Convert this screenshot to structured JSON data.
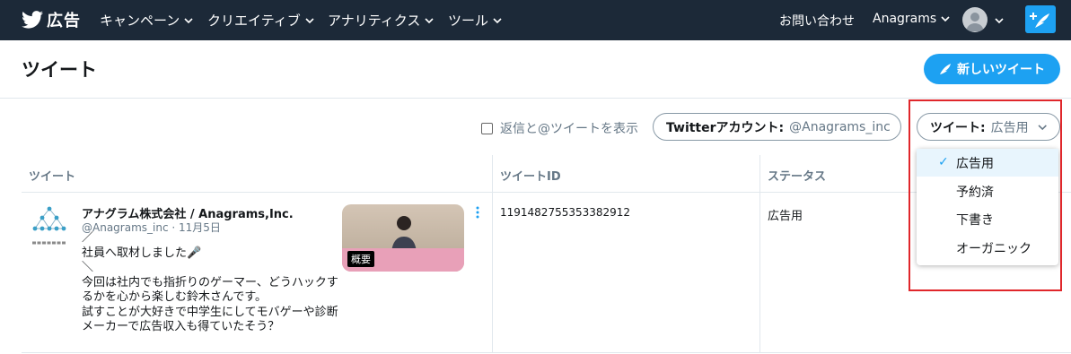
{
  "topnav": {
    "brand": "広告",
    "menu": [
      {
        "label": "キャンペーン"
      },
      {
        "label": "クリエイティブ"
      },
      {
        "label": "アナリティクス"
      },
      {
        "label": "ツール"
      }
    ],
    "contact": "お問い合わせ",
    "account": "Anagrams"
  },
  "page": {
    "title": "ツイート",
    "new_tweet": "新しいツイート"
  },
  "filters": {
    "show_replies_label": "返信と@ツイートを表示",
    "twitter_account_key": "Twitterアカウント:",
    "twitter_account_value": "@Anagrams_inc",
    "tweet_type_key": "ツイート:",
    "tweet_type_value": "広告用"
  },
  "table": {
    "headers": [
      "ツイート",
      "ツイートID",
      "ステータス"
    ]
  },
  "tweet": {
    "account_name": "アナグラム株式会社 / Anagrams,Inc.",
    "meta": "@Anagrams_inc · 11月5日",
    "body": "／\n社員へ取材しました🎤\n＼\n今回は社内でも指折りのゲーマー、どうハックするかを心から楽しむ鈴木さんです。\n試すことが大好きで中学生にしてモバゲーや診断メーカーで広告収入も得ていたそう？",
    "thumb_label": "概要",
    "id": "1191482755353382912",
    "status": "広告用"
  },
  "dropdown": {
    "items": [
      {
        "label": "広告用",
        "selected": true
      },
      {
        "label": "予約済",
        "selected": false
      },
      {
        "label": "下書き",
        "selected": false
      },
      {
        "label": "オーガニック",
        "selected": false
      }
    ],
    "check": "✓"
  },
  "colors": {
    "nav_bg": "#1c2938",
    "accent": "#1da1f2",
    "highlight": "#e0272b"
  }
}
